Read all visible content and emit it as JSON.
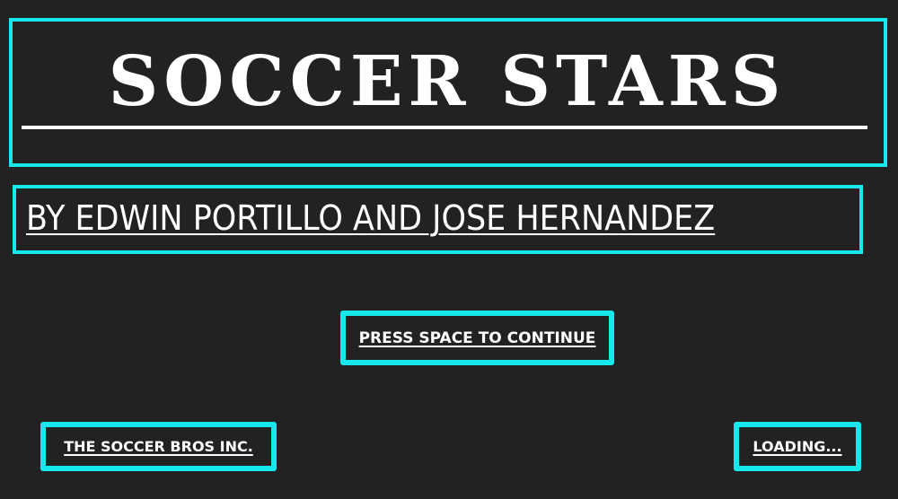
{
  "title": "SOCCER STARS",
  "byline": "BY EDWIN PORTILLO AND JOSE HERNANDEZ",
  "continue_prompt": "PRESS SPACE TO CONTINUE",
  "company": "THE SOCCER BROS INC.",
  "status": "LOADING...",
  "colors": {
    "background": "#222222",
    "accent": "#17e8ee",
    "text": "#ffffff"
  }
}
